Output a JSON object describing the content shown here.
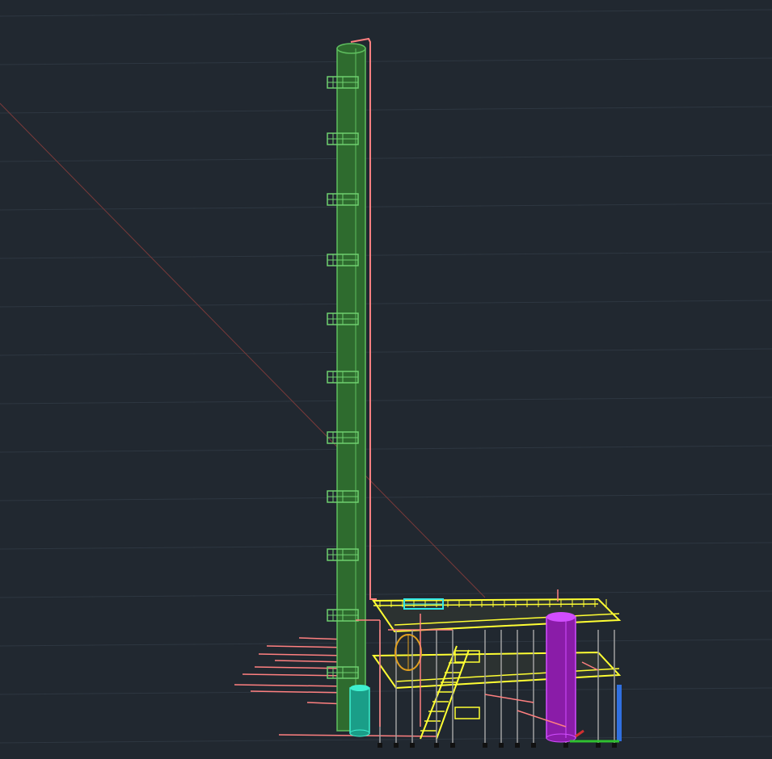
{
  "viewport": {
    "background": "#212830",
    "grid_color": "#2e3741",
    "axis_line_color": "#7a3a3a"
  },
  "model": {
    "column": {
      "fill": "#2e6b2e",
      "edge": "#5fbf5f",
      "platform": "#6fd06f"
    },
    "pipe": {
      "color": "#ff8080"
    },
    "structure": {
      "color": "#ffff33"
    },
    "vessel_purple": {
      "fill": "#8a1ca8",
      "edge": "#d14dff"
    },
    "vessel_teal": {
      "fill": "#1a9e88",
      "edge": "#3ef0d0"
    },
    "exchanger_cyan": {
      "color": "#33e6e6"
    },
    "pump_orange": {
      "color": "#e0a020"
    },
    "steel_grey": {
      "color": "#a0a0a0"
    },
    "ucs_icon": {
      "x_color": "#d03030",
      "y_color": "#30c030",
      "z_color": "#3070e0"
    }
  }
}
